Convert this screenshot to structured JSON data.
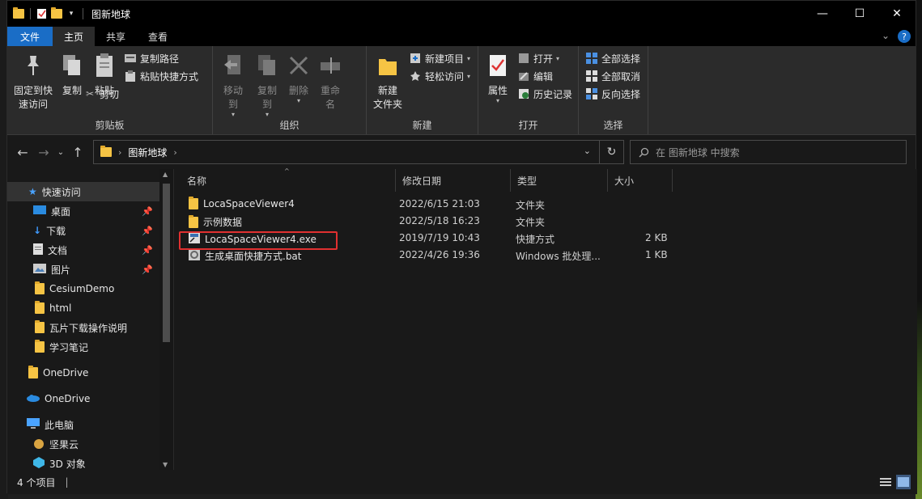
{
  "window": {
    "title": "图新地球",
    "controls": {
      "minimize": "—",
      "maximize": "☐",
      "close": "✕"
    }
  },
  "tabs": [
    {
      "label": "文件"
    },
    {
      "label": "主页"
    },
    {
      "label": "共享"
    },
    {
      "label": "查看"
    }
  ],
  "ribbon": {
    "clipboard": {
      "label": "剪贴板",
      "pin_label": "固定到快速访问",
      "pin_line1": "固定到快",
      "pin_line2": "速访问",
      "copy": "复制",
      "paste": "粘贴",
      "copy_path": "复制路径",
      "paste_shortcut": "粘贴快捷方式",
      "cut": "剪切"
    },
    "organize": {
      "label": "组织",
      "move_to": "移动到",
      "copy_to": "复制到",
      "delete": "删除",
      "rename": "重命名"
    },
    "new": {
      "label": "新建",
      "new_folder_line1": "新建",
      "new_folder_line2": "文件夹",
      "new_item": "新建项目",
      "easy_access": "轻松访问"
    },
    "open": {
      "label": "打开",
      "properties": "属性",
      "open": "打开",
      "edit": "编辑",
      "history": "历史记录"
    },
    "select": {
      "label": "选择",
      "select_all": "全部选择",
      "select_none": "全部取消",
      "invert": "反向选择"
    }
  },
  "address": {
    "crumb": "图新地球"
  },
  "search": {
    "placeholder": "在 图新地球 中搜索"
  },
  "nav": {
    "quick_access": "快速访问",
    "items": [
      {
        "label": "桌面",
        "pinned": true
      },
      {
        "label": "下载",
        "pinned": true
      },
      {
        "label": "文档",
        "pinned": true
      },
      {
        "label": "图片",
        "pinned": true
      },
      {
        "label": "CesiumDemo"
      },
      {
        "label": "html"
      },
      {
        "label": "瓦片下载操作说明"
      },
      {
        "label": "学习笔记"
      }
    ],
    "onedrive1": "OneDrive",
    "onedrive2": "OneDrive",
    "this_pc": "此电脑",
    "jianguoyun": "坚果云",
    "objects3d": "3D 对象"
  },
  "columns": {
    "name": "名称",
    "modified": "修改日期",
    "type": "类型",
    "size": "大小"
  },
  "files": [
    {
      "name": "LocaSpaceViewer4",
      "modified": "2022/6/15 21:03",
      "type": "文件夹",
      "size": "",
      "icon": "folder-icon"
    },
    {
      "name": "示例数据",
      "modified": "2022/5/18 16:23",
      "type": "文件夹",
      "size": "",
      "icon": "folder-icon"
    },
    {
      "name": "LocaSpaceViewer4.exe",
      "modified": "2019/7/19 10:43",
      "type": "快捷方式",
      "size": "2 KB",
      "icon": "shortcut-icon"
    },
    {
      "name": "生成桌面快捷方式.bat",
      "modified": "2022/4/26 19:36",
      "type": "Windows 批处理...",
      "size": "1 KB",
      "icon": "bat-file-icon"
    }
  ],
  "status": {
    "count": "4 个项目"
  },
  "colors": {
    "accent": "#1a6dc6",
    "folder": "#f6c444",
    "highlight": "#e03030"
  }
}
